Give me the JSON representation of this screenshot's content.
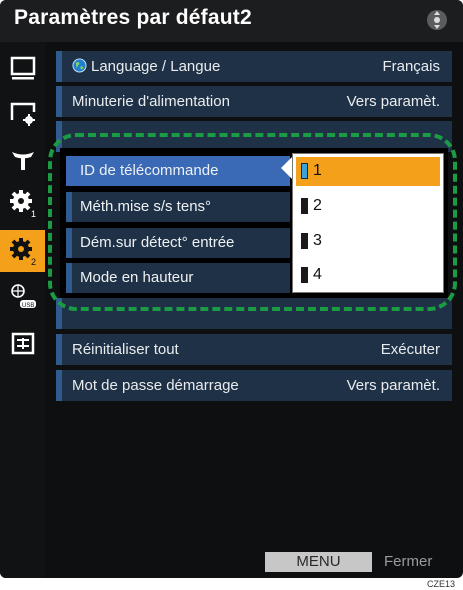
{
  "header": {
    "title": "Paramètres par défaut2",
    "nav_icon": "dpad-navigation-icon"
  },
  "sidebar": {
    "items": [
      {
        "icon": "monitor-icon",
        "active": false
      },
      {
        "icon": "screen-settings-icon",
        "active": false
      },
      {
        "icon": "antenna-icon",
        "active": false
      },
      {
        "icon": "gear-1-icon",
        "active": false
      },
      {
        "icon": "gear-2-icon",
        "active": true
      },
      {
        "icon": "network-usb-icon",
        "active": false
      },
      {
        "icon": "layout-panel-icon",
        "active": false
      }
    ]
  },
  "settings": {
    "language": {
      "label": "Language / Langue",
      "value": "Français"
    },
    "power_timer": {
      "label": "Minuterie d'alimentation",
      "value": "Vers paramèt."
    },
    "remote_id": {
      "label": "ID de télécommande",
      "value": "1"
    },
    "power_on_method": {
      "label": "Méth.mise s/s tens°",
      "value": ""
    },
    "start_on_input": {
      "label": "Dém.sur détect° entrée",
      "value": ""
    },
    "altitude_mode": {
      "label": "Mode en hauteur",
      "value": ""
    },
    "reset_all": {
      "label": "Réinitialiser tout",
      "value": "Exécuter"
    },
    "startup_password": {
      "label": "Mot de passe démarrage",
      "value": "Vers paramèt."
    }
  },
  "dropdown": {
    "options": [
      "1",
      "2",
      "3",
      "4"
    ],
    "selected": "1"
  },
  "footer": {
    "menu_label": "MENU",
    "close_label": "Fermer"
  },
  "figure_code": "CZE13",
  "colors": {
    "accent": "#f5a01a",
    "row_bg": "#1f3146",
    "row_stripe": "#2f5b8e",
    "selected_row": "#3a69b5",
    "highlight": "#1c9b45"
  }
}
